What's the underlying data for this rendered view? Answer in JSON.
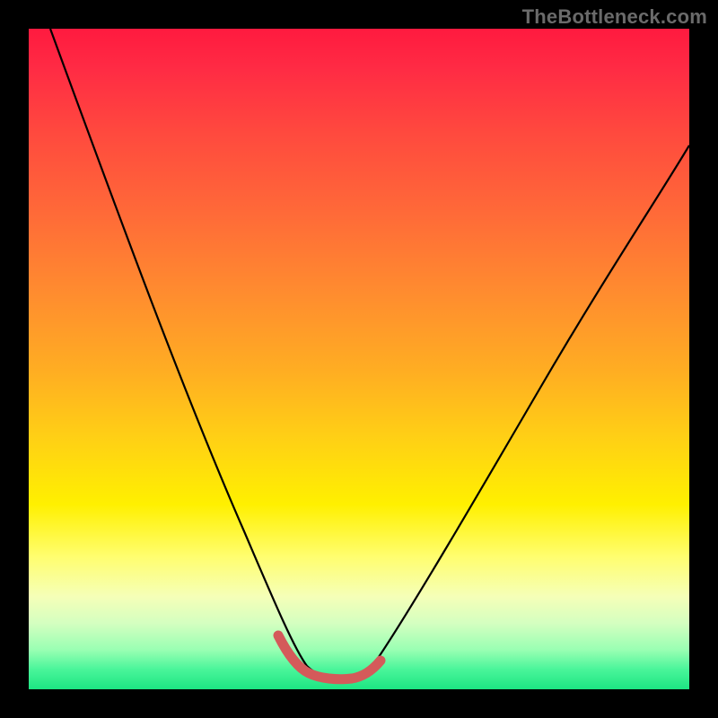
{
  "watermark": "TheBottleneck.com",
  "colors": {
    "background": "#000000",
    "gradient_top": "#ff1a3f",
    "gradient_bottom": "#1de582",
    "curve": "#000000",
    "highlight": "#d45a5a"
  },
  "chart_data": {
    "type": "line",
    "title": "",
    "xlabel": "",
    "ylabel": "",
    "xlim": [
      0,
      100
    ],
    "ylim": [
      0,
      100
    ],
    "annotations": [],
    "series": [
      {
        "name": "bottleneck-curve",
        "x": [
          0,
          3,
          6,
          9,
          12,
          15,
          18,
          21,
          24,
          27,
          30,
          33,
          36,
          37.5,
          39,
          41,
          43,
          45,
          47,
          49,
          50.5,
          53,
          56,
          60,
          64,
          68,
          72,
          76,
          80,
          84,
          88,
          92,
          96,
          100
        ],
        "y": [
          100,
          93,
          86,
          79,
          72,
          65,
          58,
          51,
          44,
          37,
          30,
          23,
          16,
          12,
          8.5,
          5.5,
          3.2,
          1.8,
          1.2,
          1.4,
          2.0,
          3.5,
          6,
          10,
          15,
          20,
          25,
          30,
          35,
          40,
          45,
          50,
          55,
          60
        ]
      },
      {
        "name": "optimal-zone-highlight",
        "x": [
          37.5,
          39,
          41,
          43,
          45,
          47,
          49,
          50.5
        ],
        "y": [
          12,
          8.5,
          5.5,
          3.2,
          1.8,
          1.2,
          1.4,
          2.0
        ]
      }
    ]
  }
}
